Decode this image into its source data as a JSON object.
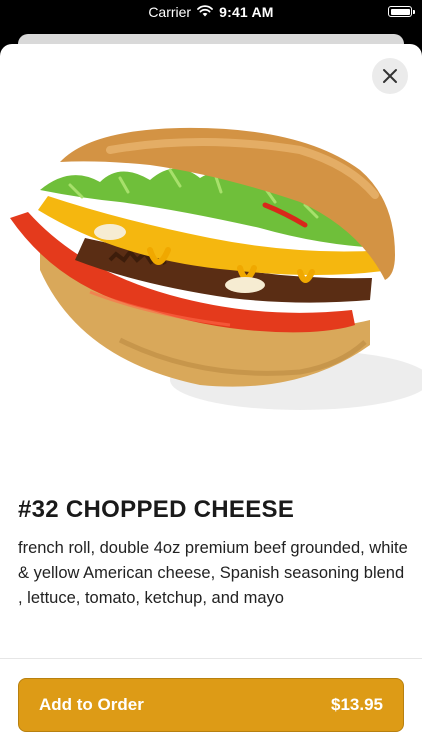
{
  "status_bar": {
    "carrier": "Carrier",
    "time": "9:41 AM",
    "wifi_icon": "wifi-icon",
    "battery_icon": "battery-icon"
  },
  "modal": {
    "close_icon": "close-icon"
  },
  "item": {
    "title": "#32 CHOPPED CHEESE",
    "description": "french roll, double 4oz premium beef grounded,  white & yellow American cheese, Spanish seasoning blend , lettuce, tomato, ketchup, and mayo",
    "image": "chopped-cheese-sandwich-image"
  },
  "order_button": {
    "label": "Add to Order",
    "price": "$13.95"
  },
  "colors": {
    "accent": "#dd9b16",
    "background": "#ffffff"
  }
}
